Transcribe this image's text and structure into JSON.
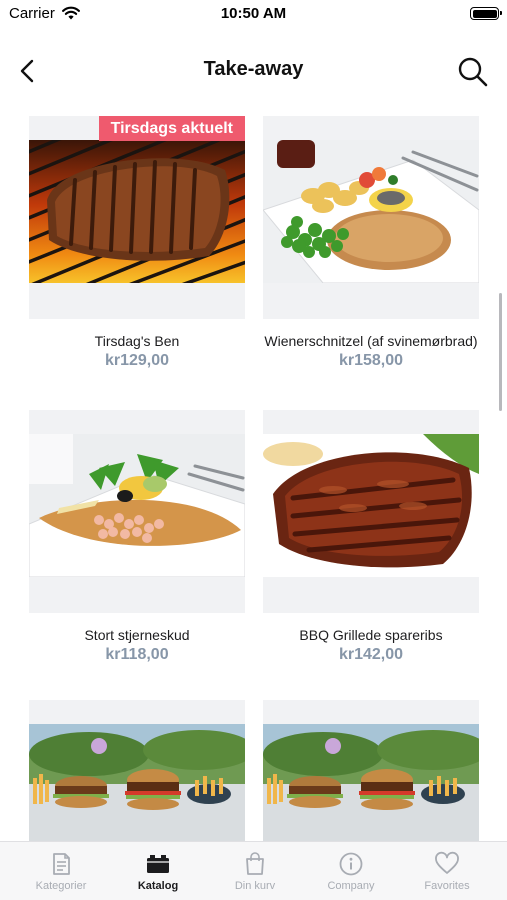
{
  "status_bar": {
    "carrier": "Carrier",
    "time": "10:50 AM"
  },
  "nav": {
    "title": "Take-away",
    "back_icon": "chevron-left-icon",
    "search_icon": "search-icon"
  },
  "products": [
    {
      "name": "Tirsdag's Ben",
      "price": "kr129,00",
      "badge": "Tirsdags aktuelt",
      "image": "grilled-ribs-photo"
    },
    {
      "name": "Wienerschnitzel (af svinemørbrad)",
      "price": "kr158,00",
      "image": "schnitzel-photo"
    },
    {
      "name": "Stort stjerneskud",
      "price": "kr118,00",
      "image": "stjerneskud-photo"
    },
    {
      "name": "BBQ Grillede spareribs",
      "price": "kr142,00",
      "image": "bbq-spareribs-photo"
    },
    {
      "name": "",
      "price": "",
      "image": "burger-photo"
    },
    {
      "name": "",
      "price": "",
      "image": "burger-photo"
    }
  ],
  "tabs": [
    {
      "label": "Kategorier",
      "icon": "document-icon",
      "active": false
    },
    {
      "label": "Katalog",
      "icon": "catalog-icon",
      "active": true
    },
    {
      "label": "Din kurv",
      "icon": "shopping-bag-icon",
      "active": false
    },
    {
      "label": "Company",
      "icon": "info-circle-icon",
      "active": false
    },
    {
      "label": "Favorites",
      "icon": "heart-icon",
      "active": false
    }
  ],
  "colors": {
    "badge": "#ef5a6e",
    "price": "#8796a8",
    "tab_inactive": "#a8acb3",
    "tab_active": "#1c1c1e"
  }
}
